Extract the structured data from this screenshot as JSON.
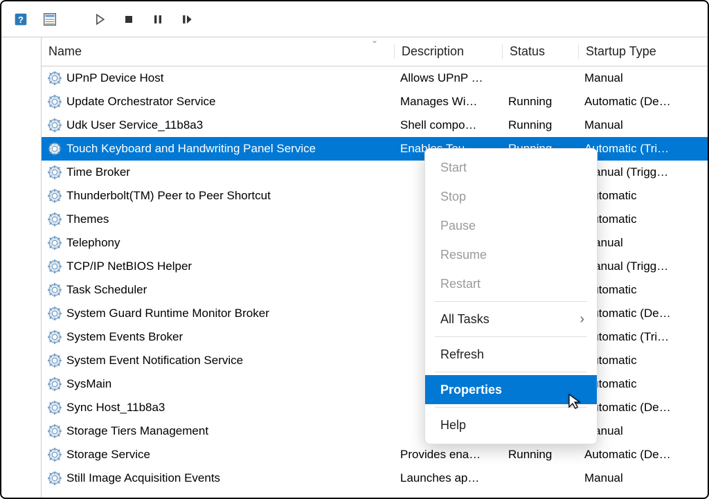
{
  "columns": {
    "name": "Name",
    "description": "Description",
    "status": "Status",
    "startup": "Startup Type"
  },
  "services": [
    {
      "name": "UPnP Device Host",
      "desc": "Allows UPnP …",
      "status": "",
      "startup": "Manual"
    },
    {
      "name": "Update Orchestrator Service",
      "desc": "Manages Wi…",
      "status": "Running",
      "startup": "Automatic (De…"
    },
    {
      "name": "Udk User Service_11b8a3",
      "desc": "Shell compo…",
      "status": "Running",
      "startup": "Manual"
    },
    {
      "name": "Touch Keyboard and Handwriting Panel Service",
      "desc": "Enables Tou…",
      "status": "Running",
      "startup": "Automatic (Tri…",
      "selected": true
    },
    {
      "name": "Time Broker",
      "desc": "",
      "status": "",
      "startup": "Manual (Trigg…"
    },
    {
      "name": "Thunderbolt(TM) Peer to Peer Shortcut",
      "desc": "",
      "status": "",
      "startup": "Automatic"
    },
    {
      "name": "Themes",
      "desc": "",
      "status": "",
      "startup": "Automatic"
    },
    {
      "name": "Telephony",
      "desc": "",
      "status": "",
      "startup": "Manual"
    },
    {
      "name": "TCP/IP NetBIOS Helper",
      "desc": "",
      "status": "",
      "startup": "Manual (Trigg…"
    },
    {
      "name": "Task Scheduler",
      "desc": "",
      "status": "",
      "startup": "Automatic"
    },
    {
      "name": "System Guard Runtime Monitor Broker",
      "desc": "",
      "status": "",
      "startup": "Automatic (De…"
    },
    {
      "name": "System Events Broker",
      "desc": "",
      "status": "",
      "startup": "Automatic (Tri…"
    },
    {
      "name": "System Event Notification Service",
      "desc": "",
      "status": "",
      "startup": "Automatic"
    },
    {
      "name": "SysMain",
      "desc": "",
      "status": "",
      "startup": "Automatic"
    },
    {
      "name": "Sync Host_11b8a3",
      "desc": "",
      "status": "",
      "startup": "Automatic (De…"
    },
    {
      "name": "Storage Tiers Management",
      "desc": "",
      "status": "",
      "startup": "Manual"
    },
    {
      "name": "Storage Service",
      "desc": "Provides ena…",
      "status": "Running",
      "startup": "Automatic (De…"
    },
    {
      "name": "Still Image Acquisition Events",
      "desc": "Launches ap…",
      "status": "",
      "startup": "Manual"
    }
  ],
  "context_menu": [
    {
      "label": "Start",
      "disabled": true
    },
    {
      "label": "Stop",
      "disabled": true
    },
    {
      "label": "Pause",
      "disabled": true
    },
    {
      "label": "Resume",
      "disabled": true
    },
    {
      "label": "Restart",
      "disabled": true
    },
    {
      "sep": true
    },
    {
      "label": "All Tasks",
      "submenu": true
    },
    {
      "sep": true
    },
    {
      "label": "Refresh"
    },
    {
      "sep": true
    },
    {
      "label": "Properties",
      "highlight": true
    },
    {
      "sep": true
    },
    {
      "label": "Help"
    }
  ],
  "sort_indicator": "⌄"
}
